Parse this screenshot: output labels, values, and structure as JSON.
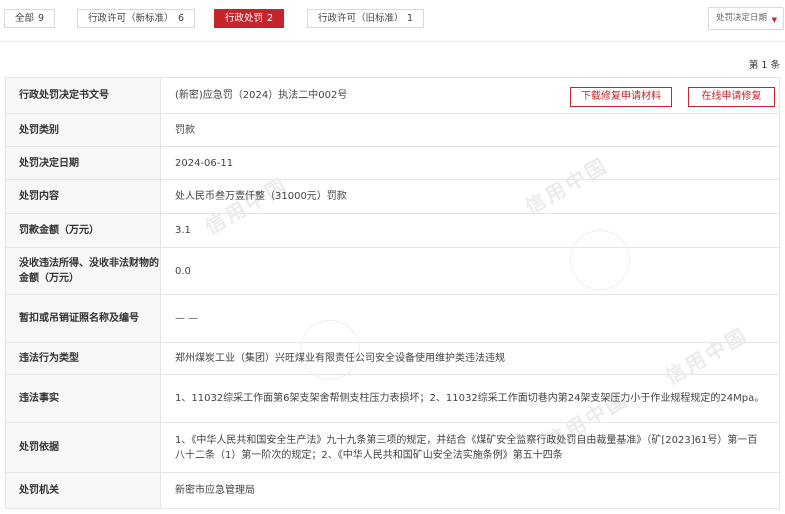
{
  "tabs": [
    {
      "label": "全部",
      "count": "9"
    },
    {
      "label": "行政许可（新标准）",
      "count": "6"
    },
    {
      "label": "行政处罚",
      "count": "2"
    },
    {
      "label": "行政许可（旧标准）",
      "count": "1"
    }
  ],
  "sort": {
    "label": "处罚决定日期"
  },
  "pager": {
    "text": "第 1 条"
  },
  "actions": {
    "download": "下载修复申请材料",
    "online": "在线申请修复"
  },
  "watermark": {
    "text": "信用中国"
  },
  "fields": [
    {
      "label": "行政处罚决定书文号",
      "value": "(新密)应急罚（2024）执法二中002号"
    },
    {
      "label": "处罚类别",
      "value": "罚款"
    },
    {
      "label": "处罚决定日期",
      "value": "2024-06-11"
    },
    {
      "label": "处罚内容",
      "value": "处人民币叁万壹仟整（31000元）罚款"
    },
    {
      "label": "罚款金额（万元）",
      "value": "3.1"
    },
    {
      "label": "没收违法所得、没收非法财物的金额（万元）",
      "value": "0.0"
    },
    {
      "label": "暂扣或吊销证照名称及编号",
      "value": "— —"
    },
    {
      "label": "违法行为类型",
      "value": "郑州煤炭工业（集团）兴旺煤业有限责任公司安全设备使用维护类违法违规"
    },
    {
      "label": "违法事实",
      "value": "1、11032综采工作面第6架支架舍帮侧支柱压力表损坏；2、11032综采工作面切巷内第24架支架压力小于作业规程规定的24Mpa。"
    },
    {
      "label": "处罚依据",
      "value": "1、《中华人民共和国安全生产法》九十九条第三项的规定，并结合《煤矿安全监察行政处罚自由裁量基准》（矿[2023]61号）第一百八十二条（1）第一阶次的规定；2、《中华人民共和国矿山安全法实施条例》第五十四条"
    },
    {
      "label": "处罚机关",
      "value": "新密市应急管理局"
    }
  ]
}
